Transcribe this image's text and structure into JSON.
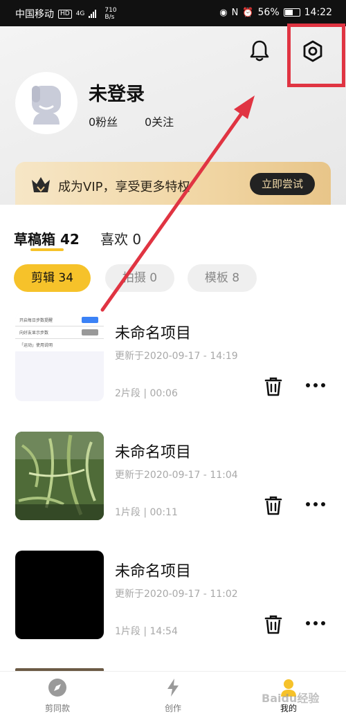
{
  "status_bar": {
    "carrier": "中国移动",
    "network_badge": "HD",
    "network_type": "4G",
    "speed_value": "710",
    "speed_unit": "B/s",
    "battery": "56%",
    "battery_level": 0.56,
    "time": "14:22",
    "icons": [
      "eye-icon",
      "nfc-icon",
      "alarm-icon",
      "battery-icon"
    ]
  },
  "header": {
    "icons": [
      "bell-icon",
      "settings-icon"
    ],
    "highlight_color": "#e03442"
  },
  "profile": {
    "username": "未登录",
    "fans": "0粉丝",
    "following": "0关注"
  },
  "vip": {
    "text": "成为VIP，享受更多特权",
    "button": "立即尝试"
  },
  "tabs": {
    "drafts": "草稿箱 42",
    "likes": "喜欢 0"
  },
  "chips": {
    "edit": "剪辑 34",
    "shoot": "拍摄 0",
    "template": "模板 8"
  },
  "projects": [
    {
      "title": "未命名项目",
      "updated": "更新于2020-09-17 - 14:19",
      "meta": "2片段 | 00:06",
      "thumb_rows": [
        "开启每日步数提醒",
        "向好友显示步数",
        "「运动」使用说明"
      ]
    },
    {
      "title": "未命名项目",
      "updated": "更新于2020-09-17 - 11:04",
      "meta": "1片段 | 00:11"
    },
    {
      "title": "未命名项目",
      "updated": "更新于2020-09-17 - 11:02",
      "meta": "1片段 | 14:54"
    }
  ],
  "bottom_nav": {
    "items": [
      {
        "label": "剪同款",
        "icon": "compass-icon"
      },
      {
        "label": "创作",
        "icon": "lightning-icon"
      },
      {
        "label": "我的",
        "icon": "user-icon"
      }
    ]
  },
  "watermark": "Baidu经验",
  "colors": {
    "accent": "#f6c22a",
    "vip_gold": "#f1d6a4",
    "annotation_red": "#e03442"
  }
}
